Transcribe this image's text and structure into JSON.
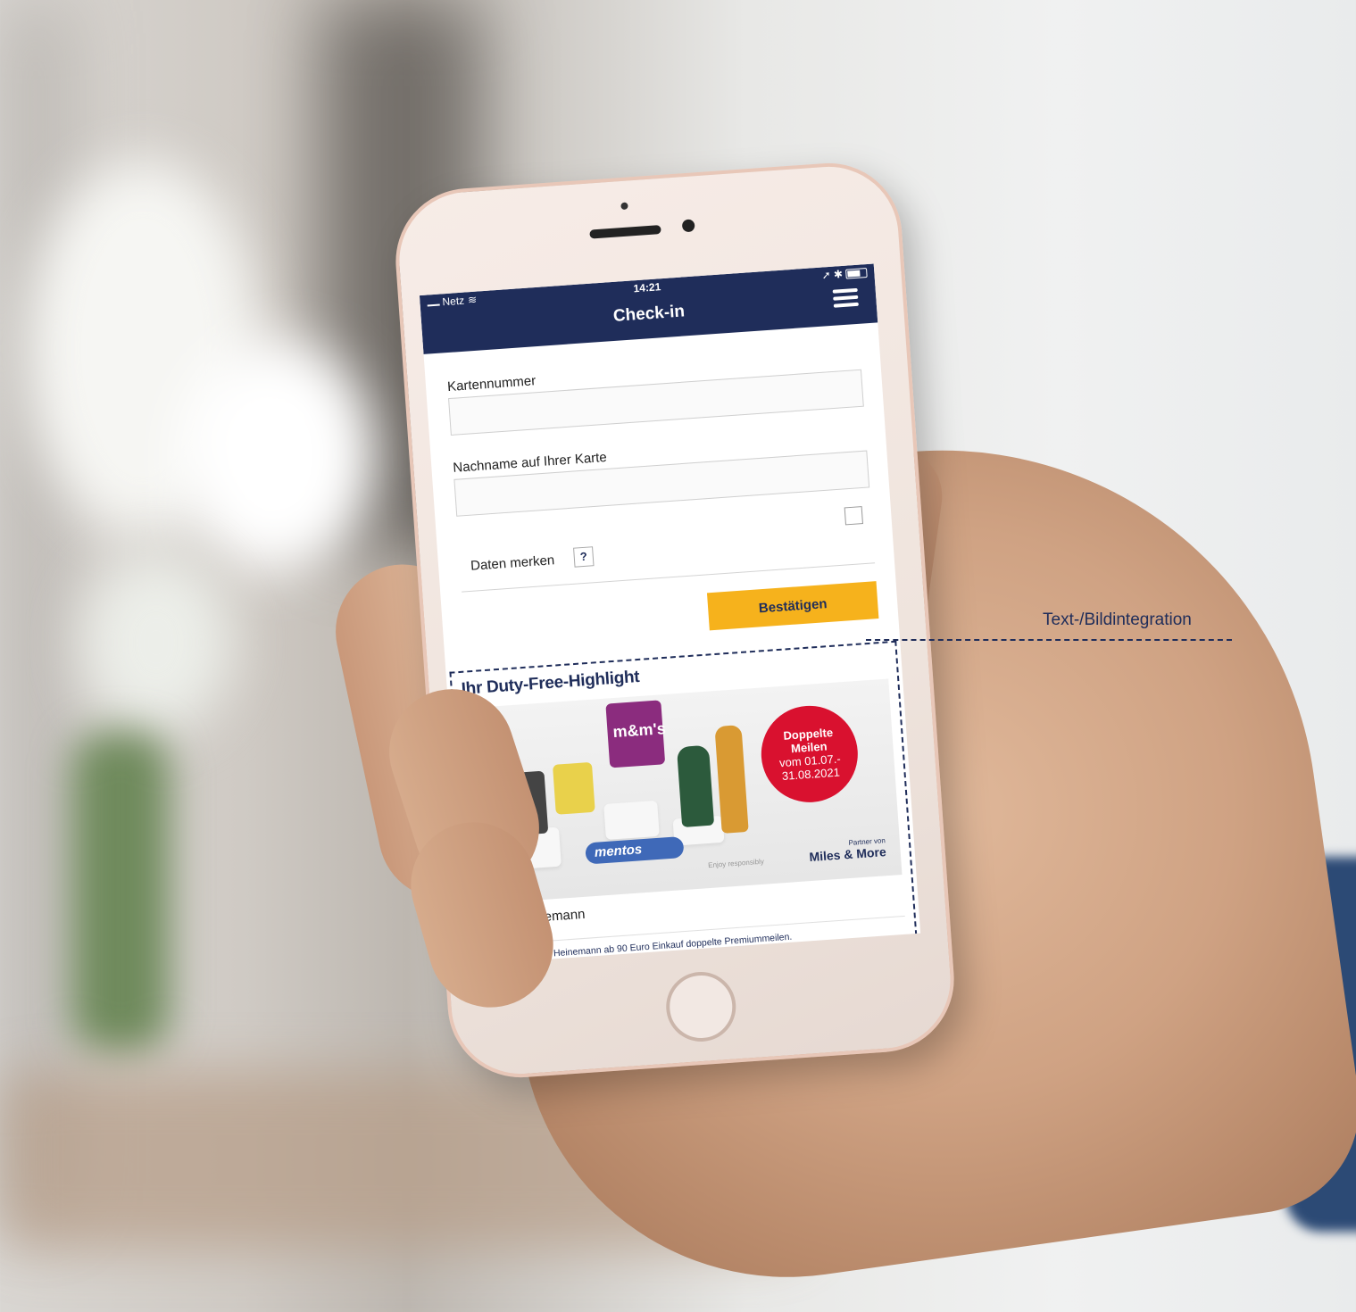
{
  "status_bar": {
    "carrier": "Netz",
    "time": "14:21"
  },
  "nav": {
    "title": "Check-in"
  },
  "form": {
    "card_number_label": "Kartennummer",
    "card_number_value": "",
    "last_name_label": "Nachname auf Ihrer Karte",
    "last_name_value": "",
    "remember_label": "Daten merken",
    "help_label": "?",
    "confirm_label": "Bestätigen"
  },
  "ad": {
    "title": "Ihr Duty-Free-Highlight",
    "product_mm": "m&m's",
    "product_mentos": "mentos",
    "badge_line1": "Doppelte",
    "badge_line2": "Meilen",
    "badge_line3": "vom 01.07.-",
    "badge_line4": "31.08.2021",
    "enjoy": "Enjoy responsibly",
    "partner_small": "Partner von",
    "partner_big": "Miles & More",
    "brand": "Heinemann",
    "caption": "Sammeln Sie bei Heinemann ab 90 Euro Einkauf doppelte Premiummeilen."
  },
  "callout": {
    "label": "Text-/Bildintegration"
  },
  "colors": {
    "nav_blue": "#1f2d5a",
    "button_yellow": "#f6b21c",
    "badge_red": "#d9112f"
  },
  "icons": [
    "signal-icon",
    "wifi-icon",
    "bluetooth-icon",
    "battery-icon",
    "menu-icon",
    "help-icon"
  ]
}
